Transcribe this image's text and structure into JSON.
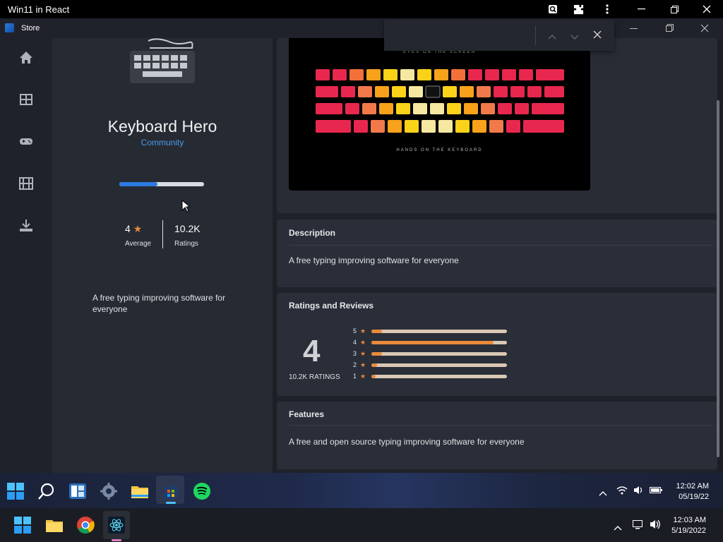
{
  "outer_window": {
    "title": "Win11 in React"
  },
  "store_window": {
    "title": "Store"
  },
  "app": {
    "name": "Keyboard Hero",
    "category": "Community",
    "progress": 0.45,
    "rating_value": "4",
    "rating_label": "Average",
    "ratings_count": "10.2K",
    "ratings_label": "Ratings",
    "short_description": "A free typing improving software for everyone"
  },
  "screenshot": {
    "top_caption": "EYES ON THE SCREEN",
    "bottom_caption": "HANDS ON THE KEYBOARD"
  },
  "description": {
    "title": "Description",
    "text": "A free typing improving software for everyone"
  },
  "ratings_reviews": {
    "title": "Ratings and Reviews",
    "big_rating": "4",
    "count_label": "10.2K RATINGS",
    "bars": [
      {
        "stars": "5",
        "fraction": 0.08
      },
      {
        "stars": "4",
        "fraction": 0.9
      },
      {
        "stars": "3",
        "fraction": 0.08
      },
      {
        "stars": "2",
        "fraction": 0.04
      },
      {
        "stars": "1",
        "fraction": 0.03
      }
    ]
  },
  "features": {
    "title": "Features",
    "text": "A free and open source typing improving software for everyone"
  },
  "inner_taskbar": {
    "time": "12:02 AM",
    "date": "05/19/22"
  },
  "outer_taskbar": {
    "time": "12:03 AM",
    "date": "5/19/2022"
  },
  "colors": {
    "accent": "#2d7be0",
    "star": "#e98a3a",
    "link": "#4a9be8"
  }
}
